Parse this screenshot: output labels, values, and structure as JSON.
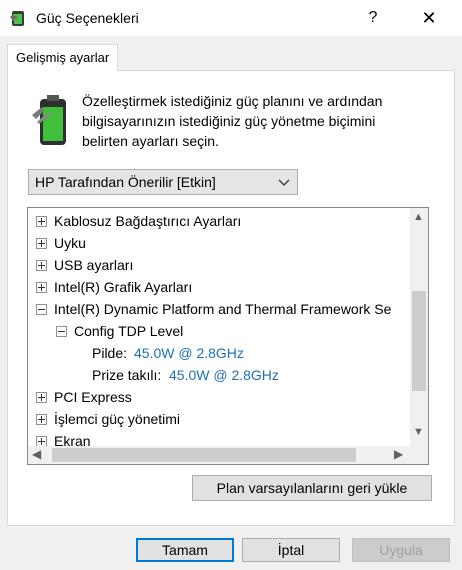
{
  "window": {
    "title": "Güç Seçenekleri",
    "help_glyph": "?",
    "close_glyph": "✕"
  },
  "tab": {
    "label": "Gelişmiş ayarlar"
  },
  "description": {
    "line1": "Özelleştirmek istediğiniz güç planını ve ardından",
    "line2": "bilgisayarınızın istediğiniz güç yönetme biçimini",
    "line3": "belirten ayarları seçin."
  },
  "plan_select": {
    "value": "HP Tarafından Önerilir [Etkin]"
  },
  "tree": {
    "items": [
      {
        "label": "Kablosuz Bağdaştırıcı Ayarları",
        "state": "collapsed"
      },
      {
        "label": "Uyku",
        "state": "collapsed"
      },
      {
        "label": "USB ayarları",
        "state": "collapsed"
      },
      {
        "label": "Intel(R) Grafik Ayarları",
        "state": "collapsed"
      },
      {
        "label": "Intel(R) Dynamic Platform and Thermal Framework Se",
        "state": "expanded"
      },
      {
        "label": "Config TDP Level",
        "state": "expanded"
      },
      {
        "label": "Pilde:",
        "value": "45.0W @ 2.8GHz"
      },
      {
        "label": "Prize takılı:",
        "value": "45.0W @ 2.8GHz"
      },
      {
        "label": "PCI Express",
        "state": "collapsed"
      },
      {
        "label": "İşlemci güç yönetimi",
        "state": "collapsed"
      },
      {
        "label": "Ekran",
        "state": "collapsed"
      }
    ]
  },
  "buttons": {
    "restore": "Plan varsayılanlarını geri yükle",
    "ok": "Tamam",
    "cancel": "İptal",
    "apply": "Uygula"
  },
  "colors": {
    "value_text": "#1e6fb5",
    "focus_border": "#0078d7"
  }
}
